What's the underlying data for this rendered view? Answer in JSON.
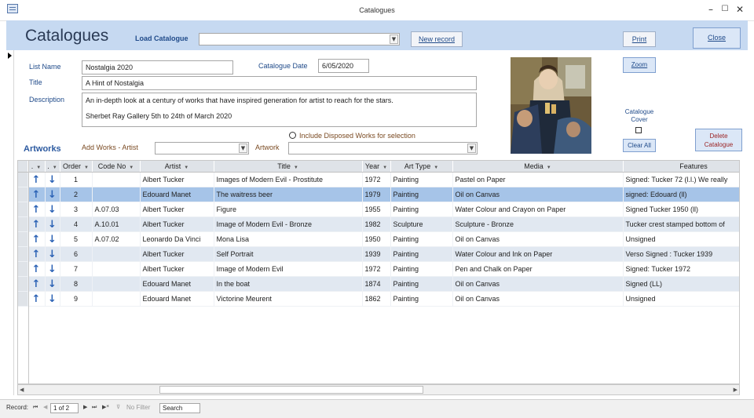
{
  "window": {
    "title": "Catalogues",
    "minimize": "–",
    "maximize": "☐",
    "close": "✕"
  },
  "header": {
    "title": "Catalogues",
    "load_catalogue_label": "Load Catalogue",
    "load_catalogue_value": "",
    "new_record_label": "New record",
    "print_label": "Print",
    "close_label": "Close"
  },
  "form": {
    "list_name_label": "List Name",
    "list_name_value": "Nostalgia 2020",
    "catalogue_date_label": "Catalogue Date",
    "catalogue_date_value": "6/05/2020",
    "title_label": "Title",
    "title_value": "A Hint of Nostalgia",
    "description_label": "Description",
    "description_line1": "An in-depth look at a century of works that have inspired generation for artist to reach for the stars.",
    "description_line2": "Sherbet Ray Gallery 5th to 24th of  March 2020",
    "include_disposed_label": "Include Disposed Works for selection",
    "zoom_label": "Zoom",
    "catalogue_cover_label1": "Catalogue",
    "catalogue_cover_label2": "Cover",
    "clear_all_label": "Clear All",
    "delete_catalogue_label1": "Delete",
    "delete_catalogue_label2": "Catalogue"
  },
  "artworks": {
    "section_label": "Artworks",
    "add_works_label": "Add Works -  Artist",
    "artist_value": "",
    "artwork_label": "Artwork",
    "artwork_value": ""
  },
  "grid": {
    "columns": [
      ".",
      ".",
      "Order",
      "Code No",
      "Artist",
      "Title",
      "Year",
      "Art Type",
      "Media",
      "Features"
    ],
    "up_arrow": "↑",
    "down_arrow": "↓",
    "rows": [
      {
        "order": "1",
        "code": "",
        "artist": "Albert Tucker",
        "title": "Images of Modern Evil - Prostitute",
        "year": "1972",
        "type": "Painting",
        "media": "Pastel on Paper",
        "features": "Signed: Tucker 72 (l.l.) We really"
      },
      {
        "order": "2",
        "code": "",
        "artist": "Edouard Manet",
        "title": "The waitress beer",
        "year": "1979",
        "type": "Painting",
        "media": "Oil on Canvas",
        "features": "signed: Edouard (ll)"
      },
      {
        "order": "3",
        "code": "A.07.03",
        "artist": "Albert Tucker",
        "title": "Figure",
        "year": "1955",
        "type": "Painting",
        "media": "Water Colour and Crayon on Paper",
        "features": "Signed Tucker 1950 (ll)"
      },
      {
        "order": "4",
        "code": "A.10.01",
        "artist": "Albert Tucker",
        "title": "Image of Modern Evil - Bronze",
        "year": "1982",
        "type": "Sculpture",
        "media": "Sculpture - Bronze",
        "features": "Tucker crest stamped bottom of"
      },
      {
        "order": "5",
        "code": "A.07.02",
        "artist": "Leonardo Da Vinci",
        "title": "Mona Lisa",
        "year": "1950",
        "type": "Painting",
        "media": "Oil on Canvas",
        "features": "Unsigned"
      },
      {
        "order": "6",
        "code": "",
        "artist": "Albert Tucker",
        "title": "Self Portrait",
        "year": "1939",
        "type": "Painting",
        "media": "Water Colour and Ink on Paper",
        "features": "Verso Signed : Tucker 1939"
      },
      {
        "order": "7",
        "code": "",
        "artist": "Albert Tucker",
        "title": "Image of Modern Evil",
        "year": "1972",
        "type": "Painting",
        "media": "Pen and Chalk on Paper",
        "features": "Signed: Tucker 1972"
      },
      {
        "order": "8",
        "code": "",
        "artist": "Edouard Manet",
        "title": "In the boat",
        "year": "1874",
        "type": "Painting",
        "media": "Oil on Canvas",
        "features": "Signed (LL)"
      },
      {
        "order": "9",
        "code": "",
        "artist": "Edouard Manet",
        "title": "Victorine Meurent",
        "year": "1862",
        "type": "Painting",
        "media": "Oil on Canvas",
        "features": "Unsigned"
      }
    ]
  },
  "statusbar": {
    "record_label": "Record:",
    "record_value": "1 of 2",
    "no_filter_label": "No Filter",
    "search_label": "Search"
  },
  "colors": {
    "header_band": "#c6d9f1",
    "selected_row": "#a6c4e8",
    "alt_row": "#e1e8f1",
    "label_blue": "#204b8a",
    "label_brown": "#7a4a22"
  }
}
